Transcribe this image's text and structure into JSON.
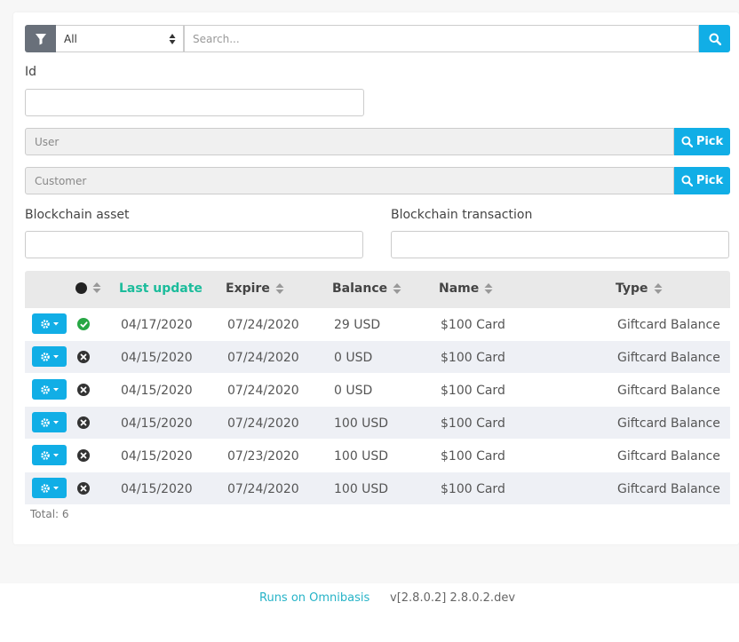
{
  "search": {
    "filter_selected": "All",
    "placeholder": "Search..."
  },
  "form": {
    "id_label": "Id",
    "id_value": "",
    "user_placeholder": "User",
    "customer_placeholder": "Customer",
    "pick_label": "Pick",
    "blockchain_asset_label": "Blockchain asset",
    "blockchain_transaction_label": "Blockchain transaction"
  },
  "table": {
    "columns": {
      "last_update": "Last update",
      "expire": "Expire",
      "balance": "Balance",
      "name": "Name",
      "type": "Type"
    },
    "rows": [
      {
        "status": "ok",
        "last_update": "04/17/2020",
        "expire": "07/24/2020",
        "balance": "29 USD",
        "name": "$100 Card",
        "type": "Giftcard Balance"
      },
      {
        "status": "x",
        "last_update": "04/15/2020",
        "expire": "07/24/2020",
        "balance": "0 USD",
        "name": "$100 Card",
        "type": "Giftcard Balance"
      },
      {
        "status": "x",
        "last_update": "04/15/2020",
        "expire": "07/24/2020",
        "balance": "0 USD",
        "name": "$100 Card",
        "type": "Giftcard Balance"
      },
      {
        "status": "x",
        "last_update": "04/15/2020",
        "expire": "07/24/2020",
        "balance": "100 USD",
        "name": "$100 Card",
        "type": "Giftcard Balance"
      },
      {
        "status": "x",
        "last_update": "04/15/2020",
        "expire": "07/23/2020",
        "balance": "100 USD",
        "name": "$100 Card",
        "type": "Giftcard Balance"
      },
      {
        "status": "x",
        "last_update": "04/15/2020",
        "expire": "07/24/2020",
        "balance": "100 USD",
        "name": "$100 Card",
        "type": "Giftcard Balance"
      }
    ],
    "total": "Total: 6"
  },
  "footer": {
    "link": "Runs on Omnibasis",
    "version": "v[2.8.0.2] 2.8.0.2.dev"
  },
  "colors": {
    "accent": "#11aee6",
    "active_sort": "#1bbc9b",
    "ok": "#28a745",
    "x": "#333333"
  }
}
